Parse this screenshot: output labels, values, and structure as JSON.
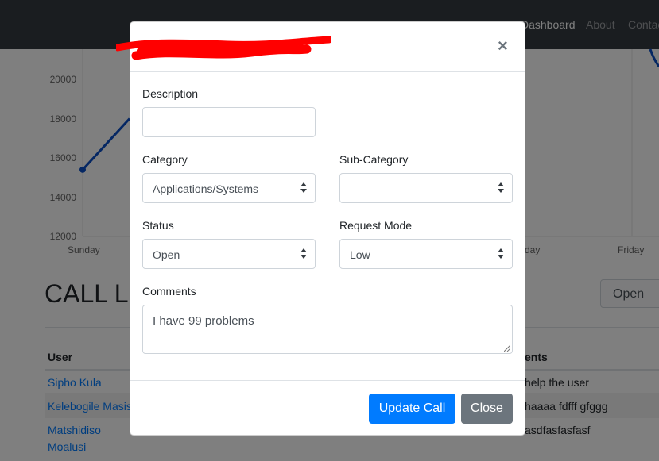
{
  "navbar": {
    "links": [
      "Dashboard",
      "About",
      "Contact"
    ]
  },
  "chart_data": {
    "type": "line",
    "y_ticks": [
      "20000",
      "18000",
      "16000",
      "14000",
      "12000"
    ],
    "x_ticks_visible": [
      "Sunday",
      "day",
      "Friday"
    ],
    "series": [
      {
        "values": [
          15400,
          18000
        ]
      }
    ],
    "ylim": [
      12000,
      21000
    ],
    "color": "#0b4fc7"
  },
  "page": {
    "heading": "CALL LO",
    "open_button": "Open",
    "table": {
      "headers": [
        "User",
        "ents"
      ],
      "rows": [
        {
          "user": "Sipho Kula",
          "comment": "help the user"
        },
        {
          "user": "Kelebogile Masis",
          "comment": "haaaa fdfff gfggg"
        },
        {
          "user": "Matshidiso",
          "user2": "Moalusi",
          "comment": "asdfasfasfasf"
        }
      ]
    }
  },
  "modal": {
    "close_icon": "×",
    "description_label": "Description",
    "description_value": "",
    "category_label": "Category",
    "category_value": "Applications/Systems",
    "subcategory_label": "Sub-Category",
    "subcategory_value": "",
    "status_label": "Status",
    "status_value": "Open",
    "request_mode_label": "Request Mode",
    "request_mode_value": "Low",
    "comments_label": "Comments",
    "comments_value": "I have 99 problems",
    "update_button": "Update Call",
    "close_button": "Close"
  },
  "colors": {
    "primary": "#007bff",
    "secondary": "#6c757d",
    "navbar": "#343a40",
    "redaction": "#ff0000"
  }
}
